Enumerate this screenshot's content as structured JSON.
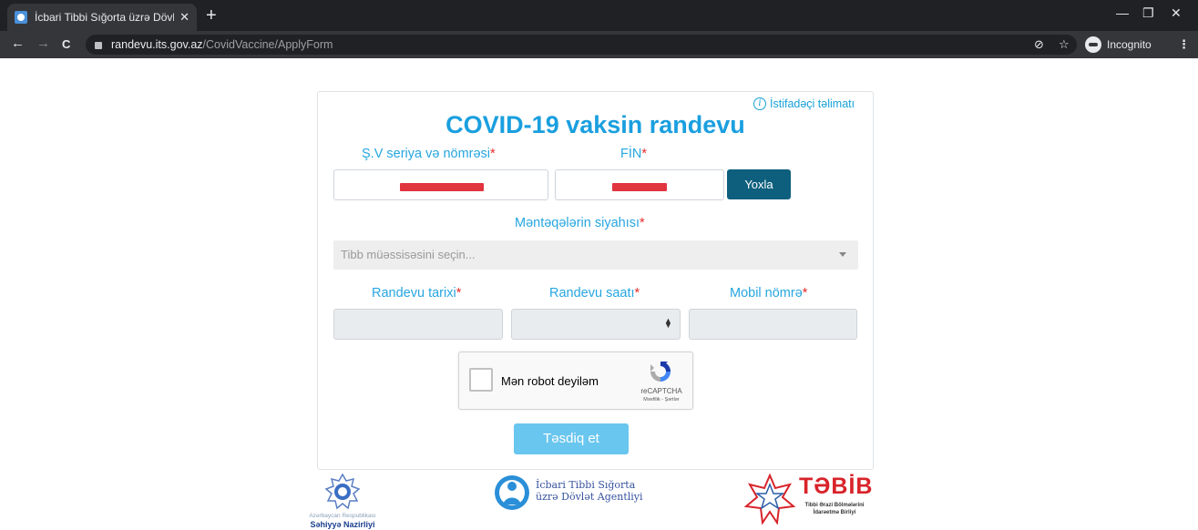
{
  "browser": {
    "tab_title": "İcbari Tibbi Sığorta üzrə Dövlət A",
    "tab_close": "✕",
    "new_tab": "+",
    "url_domain": "randevu.its.gov.az",
    "url_path": "/CovidVaccine/ApplyForm",
    "incognito_label": "Incognito",
    "back": "←",
    "forward": "→",
    "reload": "C",
    "menu": "⋮",
    "minimize": "—",
    "restore": "❐",
    "close": "✕"
  },
  "form": {
    "help_link": "İstifadəçi təlimatı",
    "title": "COVID-19 vaksin randevu",
    "id_label": "Ş.V seriya və nömrəsi",
    "fin_label": "FİN",
    "required_mark": "*",
    "check_button": "Yoxla",
    "centers_label": "Məntəqələrin siyahısı",
    "centers_placeholder": "Tibb müəssisəsini seçin...",
    "date_label": "Randevu tarixi",
    "hour_label": "Randevu saatı",
    "phone_label": "Mobil nömrə",
    "submit_button": "Təsdiq et"
  },
  "captcha": {
    "label": "Mən robot deyiləm",
    "brand": "reCAPTCHA",
    "terms": "Məxfilik - Şərtlər"
  },
  "footer": {
    "ministry_small": "Azərbaycan Respublikası",
    "ministry_name": "Səhiyyə Nazirliyi",
    "agency_line1": "İcbari Tibbi Sığorta",
    "agency_line2": "üzrə Dövlət Agentliyi",
    "tabib_name": "TƏBİB",
    "tabib_sub1": "Tibbi Ərazi Bölmələrini",
    "tabib_sub2": "İdarəetmə Birliyi"
  },
  "colors": {
    "accent": "#1a9fdf",
    "label": "#26a6e0",
    "required": "#e52c2c",
    "check_button": "#0e5f7e",
    "submit_button": "#69c6ee",
    "redaction": "#e0343f"
  }
}
